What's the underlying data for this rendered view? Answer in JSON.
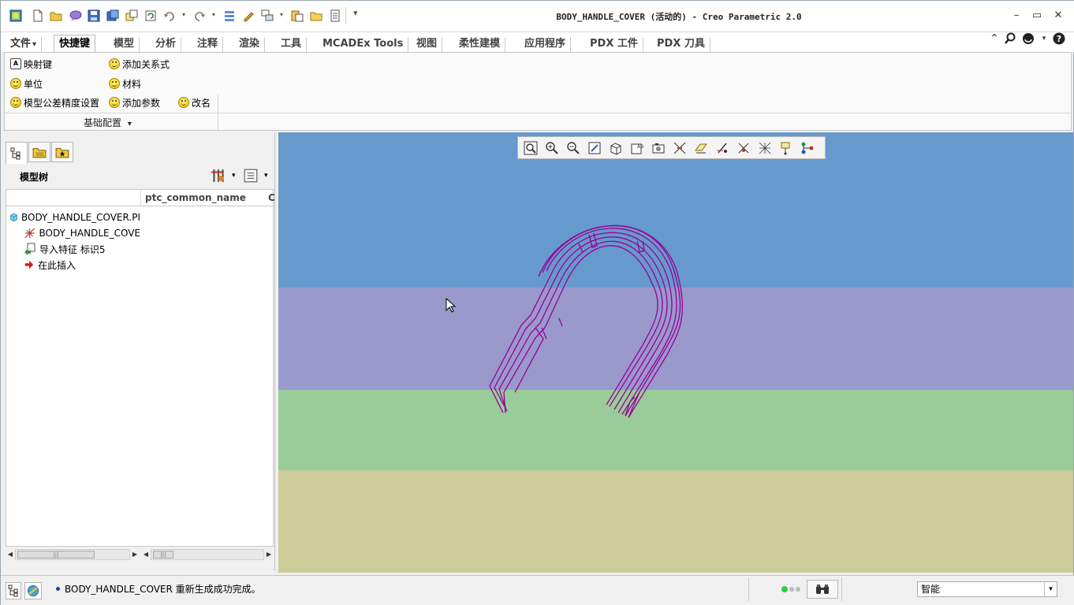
{
  "window": {
    "title": "BODY_HANDLE_COVER (活动的) - Creo Parametric 2.0"
  },
  "quick_access": [
    "view-manager-icon",
    "new-icon",
    "open-icon",
    "message-icon",
    "save-icon",
    "save-as-icon",
    "copy-icon",
    "regenerate-icon",
    "undo-icon",
    "redo-icon",
    "sort-icon",
    "paint-icon",
    "windows-icon",
    "paste-icon",
    "folder-icon",
    "doc-icon",
    "customize-icon"
  ],
  "tabs": [
    {
      "label": "文件",
      "dropdown": "▾"
    },
    {
      "label": "快捷键"
    },
    {
      "label": "模型"
    },
    {
      "label": "分析"
    },
    {
      "label": "注释"
    },
    {
      "label": "渲染"
    },
    {
      "label": "工具"
    },
    {
      "label": "MCADEx Tools"
    },
    {
      "label": "视图"
    },
    {
      "label": "柔性建模"
    },
    {
      "label": "应用程序"
    },
    {
      "label": "PDX 工件"
    },
    {
      "label": "PDX 刀具"
    }
  ],
  "ribbon": {
    "items": [
      {
        "label": "映射键",
        "icon": "keybox-icon",
        "key": "A"
      },
      {
        "label": "添加关系式",
        "icon": "smiley-icon"
      },
      {
        "label": "单位",
        "icon": "smiley-icon"
      },
      {
        "label": "材料",
        "icon": "smiley-icon"
      },
      {
        "label": "模型公差精度设置",
        "icon": "smiley-icon"
      },
      {
        "label": "添加参数",
        "icon": "smiley-icon"
      },
      {
        "label": "改名",
        "icon": "smiley-icon"
      }
    ],
    "group_label": "基础配置",
    "group_arrow": "▾"
  },
  "model_tree": {
    "title": "模型树",
    "columns": [
      "ptc_common_name",
      "C"
    ],
    "rows": [
      {
        "label": "BODY_HANDLE_COVER.PI",
        "icon": "part-icon"
      },
      {
        "label": "BODY_HANDLE_COVE",
        "icon": "csys-icon"
      },
      {
        "label": "导入特征 标识5",
        "icon": "import-feature-icon"
      },
      {
        "label": "在此插入",
        "icon": "insert-here-arrow-icon"
      }
    ]
  },
  "viewport": {
    "bands": [
      "#6699cc",
      "#9999cc",
      "#99cc99",
      "#cccc99"
    ],
    "model_color": "#990099"
  },
  "floating_toolbar": [
    "refit-icon",
    "zoom-in-icon",
    "zoom-out-icon",
    "repaint-icon",
    "display-style-icon",
    "saved-orientations-icon",
    "view-manager-icon",
    "datum-display-icon",
    "plane-display-icon",
    "axis-display-icon",
    "point-display-icon",
    "csys-display-icon",
    "annotation-display-icon",
    "spin-center-icon"
  ],
  "status": {
    "message": "BODY_HANDLE_COVER 重新生成成功完成。",
    "filter": "智能",
    "filter_arrow": "▾"
  }
}
